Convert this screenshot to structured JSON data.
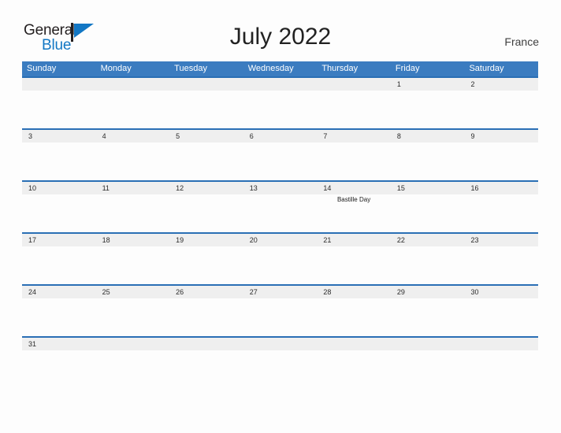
{
  "brand": {
    "name_part1": "General",
    "name_part2": "Blue",
    "flag_icon": "blue-triangle-flag-icon",
    "color_dark": "#231f20",
    "color_blue": "#1277c4"
  },
  "header": {
    "title": "July 2022",
    "country": "France",
    "accent_color": "#3b7cc0",
    "rule_color": "#2a6fb5",
    "band_color": "#efefef"
  },
  "calendar": {
    "weekday_headers": [
      "Sunday",
      "Monday",
      "Tuesday",
      "Wednesday",
      "Thursday",
      "Friday",
      "Saturday"
    ],
    "weeks": [
      {
        "days": [
          {
            "date": "",
            "event": ""
          },
          {
            "date": "",
            "event": ""
          },
          {
            "date": "",
            "event": ""
          },
          {
            "date": "",
            "event": ""
          },
          {
            "date": "",
            "event": ""
          },
          {
            "date": "1",
            "event": ""
          },
          {
            "date": "2",
            "event": ""
          }
        ]
      },
      {
        "days": [
          {
            "date": "3",
            "event": ""
          },
          {
            "date": "4",
            "event": ""
          },
          {
            "date": "5",
            "event": ""
          },
          {
            "date": "6",
            "event": ""
          },
          {
            "date": "7",
            "event": ""
          },
          {
            "date": "8",
            "event": ""
          },
          {
            "date": "9",
            "event": ""
          }
        ]
      },
      {
        "days": [
          {
            "date": "10",
            "event": ""
          },
          {
            "date": "11",
            "event": ""
          },
          {
            "date": "12",
            "event": ""
          },
          {
            "date": "13",
            "event": ""
          },
          {
            "date": "14",
            "event": "Bastille Day"
          },
          {
            "date": "15",
            "event": ""
          },
          {
            "date": "16",
            "event": ""
          }
        ]
      },
      {
        "days": [
          {
            "date": "17",
            "event": ""
          },
          {
            "date": "18",
            "event": ""
          },
          {
            "date": "19",
            "event": ""
          },
          {
            "date": "20",
            "event": ""
          },
          {
            "date": "21",
            "event": ""
          },
          {
            "date": "22",
            "event": ""
          },
          {
            "date": "23",
            "event": ""
          }
        ]
      },
      {
        "days": [
          {
            "date": "24",
            "event": ""
          },
          {
            "date": "25",
            "event": ""
          },
          {
            "date": "26",
            "event": ""
          },
          {
            "date": "27",
            "event": ""
          },
          {
            "date": "28",
            "event": ""
          },
          {
            "date": "29",
            "event": ""
          },
          {
            "date": "30",
            "event": ""
          }
        ]
      },
      {
        "days": [
          {
            "date": "31",
            "event": ""
          },
          {
            "date": "",
            "event": ""
          },
          {
            "date": "",
            "event": ""
          },
          {
            "date": "",
            "event": ""
          },
          {
            "date": "",
            "event": ""
          },
          {
            "date": "",
            "event": ""
          },
          {
            "date": "",
            "event": ""
          }
        ]
      }
    ]
  }
}
